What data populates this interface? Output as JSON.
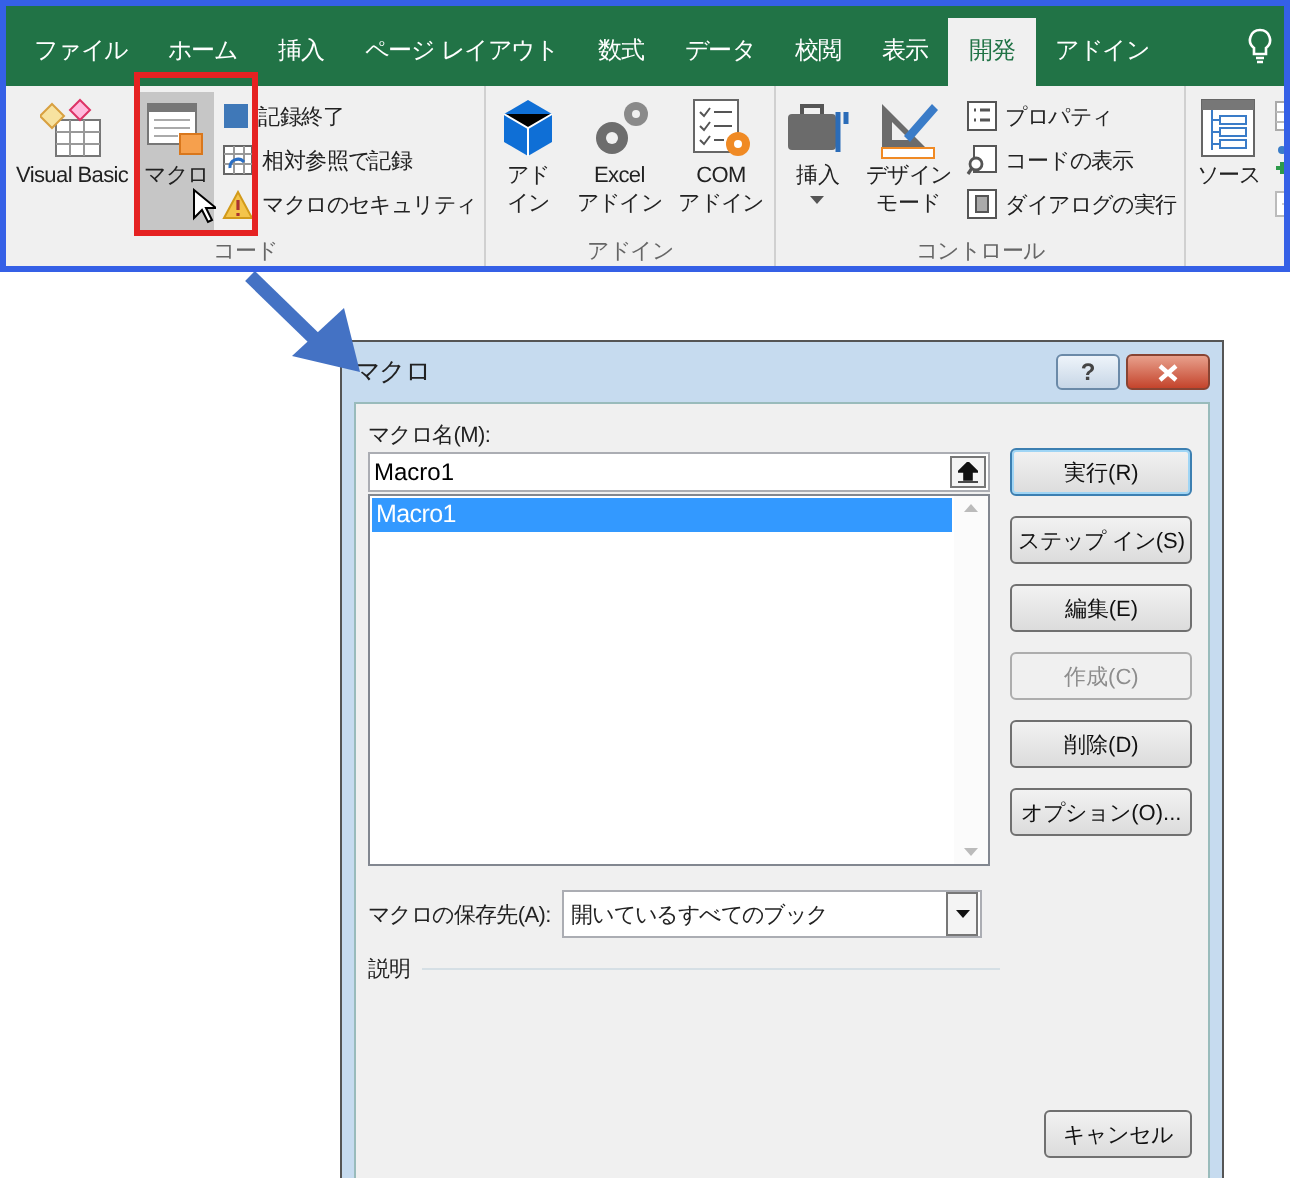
{
  "ribbon": {
    "tabs": [
      {
        "label": "ファイル",
        "selected": false
      },
      {
        "label": "ホーム",
        "selected": false
      },
      {
        "label": "挿入",
        "selected": false
      },
      {
        "label": "ページ レイアウト",
        "selected": false
      },
      {
        "label": "数式",
        "selected": false
      },
      {
        "label": "データ",
        "selected": false
      },
      {
        "label": "校閲",
        "selected": false
      },
      {
        "label": "表示",
        "selected": false
      },
      {
        "label": "開発",
        "selected": true
      },
      {
        "label": "アドイン",
        "selected": false
      }
    ],
    "groups": [
      {
        "label": "コード",
        "items": [
          {
            "kind": "large",
            "lines": [
              "Visual Basic"
            ],
            "selected": false
          },
          {
            "kind": "large",
            "lines": [
              "マクロ"
            ],
            "selected": true
          },
          {
            "kind": "small",
            "lines": [
              "記録終了"
            ],
            "selected": false
          },
          {
            "kind": "small",
            "lines": [
              "相対参照で記録"
            ],
            "selected": false
          },
          {
            "kind": "small",
            "lines": [
              "マクロのセキュリティ"
            ],
            "selected": false
          }
        ]
      },
      {
        "label": "アドイン",
        "items": [
          {
            "kind": "large",
            "lines": [
              "アド",
              "イン"
            ],
            "selected": false
          },
          {
            "kind": "large",
            "lines": [
              "Excel",
              "アドイン"
            ],
            "selected": false
          },
          {
            "kind": "large",
            "lines": [
              "COM",
              "アドイン"
            ],
            "selected": false
          }
        ]
      },
      {
        "label": "コントロール",
        "items": [
          {
            "kind": "dropdown",
            "lines": [
              "挿入"
            ],
            "selected": false
          },
          {
            "kind": "large",
            "lines": [
              "デザイン",
              "モード"
            ],
            "selected": false
          },
          {
            "kind": "small",
            "lines": [
              "プロパティ"
            ],
            "selected": false
          },
          {
            "kind": "small",
            "lines": [
              "コードの表示"
            ],
            "selected": false
          },
          {
            "kind": "small",
            "lines": [
              "ダイアログの実行"
            ],
            "selected": false
          }
        ]
      },
      {
        "items": [
          {
            "kind": "large",
            "lines": [
              "ソース"
            ]
          },
          {
            "kind": "iconsmall"
          },
          {
            "kind": "iconsmall"
          },
          {
            "kind": "iconsmall"
          }
        ]
      }
    ]
  },
  "dialog": {
    "title": "マクロ",
    "help_button": "?",
    "name_label": "マクロ名(M):",
    "name_value": "Macro1",
    "macros": [
      {
        "name": "Macro1",
        "selected": true
      }
    ],
    "buttons": [
      {
        "label": "実行(R)",
        "default": true,
        "disabled": false
      },
      {
        "label": "ステップ イン(S)",
        "default": false,
        "disabled": false
      },
      {
        "label": "編集(E)",
        "default": false,
        "disabled": false
      },
      {
        "label": "作成(C)",
        "default": false,
        "disabled": true
      },
      {
        "label": "削除(D)",
        "default": false,
        "disabled": false
      },
      {
        "label": "オプション(O)...",
        "default": false,
        "disabled": false
      }
    ],
    "location_label": "マクロの保存先(A):",
    "location_value": "開いているすべてのブック",
    "description_label": "説明",
    "cancel_button": "キャンセル"
  }
}
